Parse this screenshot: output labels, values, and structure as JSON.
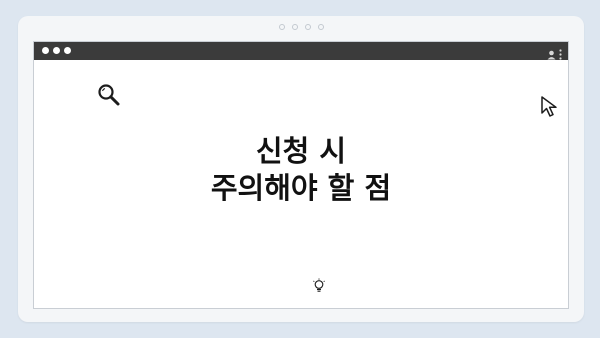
{
  "page": {
    "background_color": "#dde6f0",
    "pager_dots": 4
  },
  "window": {
    "titlebar_color": "#3b3b3b",
    "traffic_lights": 3,
    "menu_icons": [
      "user-icon",
      "more-vertical-icon"
    ]
  },
  "content": {
    "headline_line1": "신청 시",
    "headline_line2": "주의해야 할 점",
    "icons": [
      "search-icon",
      "cursor-icon",
      "lightbulb-icon"
    ]
  }
}
